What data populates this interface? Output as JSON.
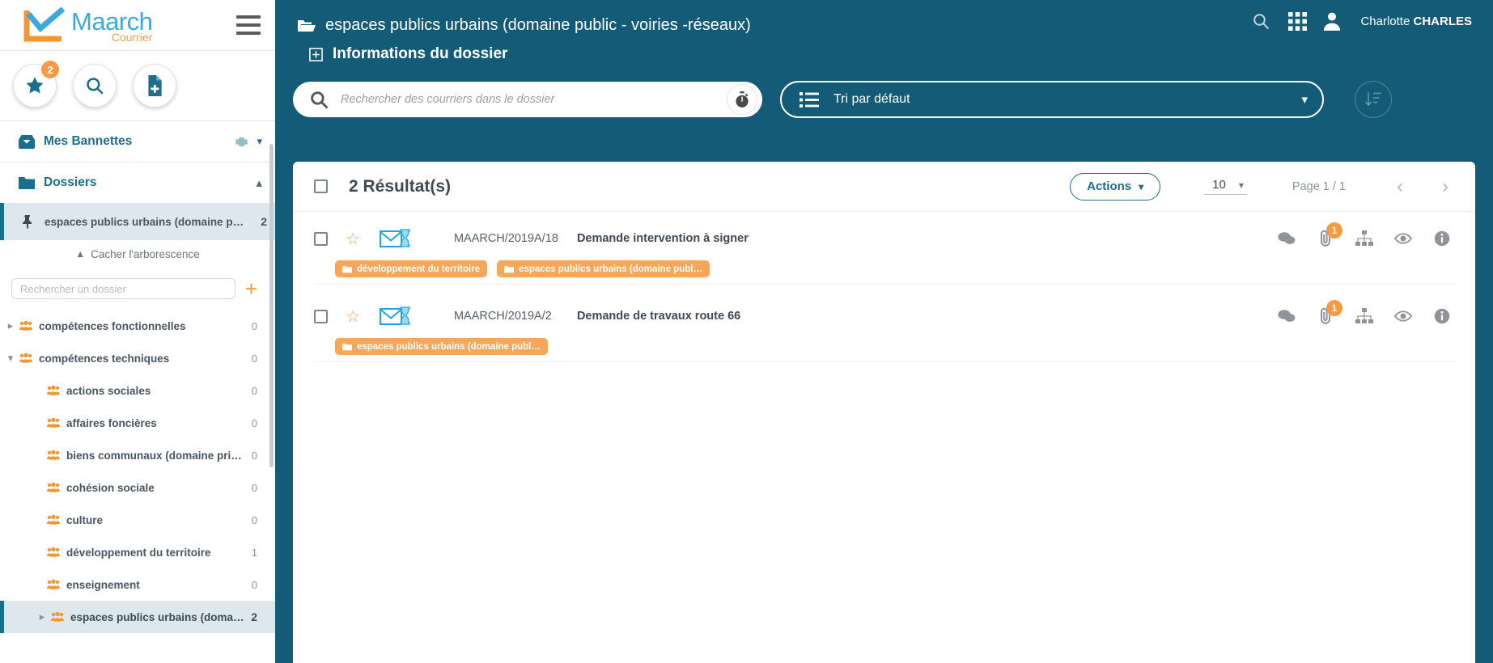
{
  "brand": {
    "name": "Maarch",
    "sub": "Courrier"
  },
  "sidebar": {
    "quick_actions": [
      {
        "name": "favorites-button",
        "icon": "star-icon",
        "badge": "2"
      },
      {
        "name": "search-button",
        "icon": "search-icon",
        "badge": ""
      },
      {
        "name": "new-document-button",
        "icon": "document-add-icon",
        "badge": ""
      }
    ],
    "baskets": {
      "label": "Mes Bannettes",
      "icon": "inbox-icon",
      "gear": "gear-icon"
    },
    "folders": {
      "label": "Dossiers",
      "icon": "folder-icon"
    },
    "pinned_folder": {
      "label": "espaces publics urbains (domaine public - voi…",
      "count": "2",
      "icon": "pin-icon"
    },
    "hide_tree_label": "Cacher l'arborescence",
    "tree_search_placeholder": "Rechercher un dossier",
    "add_folder_label": "+",
    "tree": [
      {
        "label": "compétences fonctionnelles",
        "count": "0",
        "level": 1,
        "expanded": false,
        "has_children": true,
        "active": false
      },
      {
        "label": "compétences techniques",
        "count": "0",
        "level": 1,
        "expanded": true,
        "has_children": true,
        "active": false
      },
      {
        "label": "actions sociales",
        "count": "0",
        "level": 2,
        "expanded": false,
        "has_children": false,
        "active": false
      },
      {
        "label": "affaires foncières",
        "count": "0",
        "level": 2,
        "expanded": false,
        "has_children": false,
        "active": false
      },
      {
        "label": "biens communaux (domaine privé)",
        "count": "0",
        "level": 2,
        "expanded": false,
        "has_children": false,
        "active": false
      },
      {
        "label": "cohésion sociale",
        "count": "0",
        "level": 2,
        "expanded": false,
        "has_children": false,
        "active": false
      },
      {
        "label": "culture",
        "count": "0",
        "level": 2,
        "expanded": false,
        "has_children": false,
        "active": false
      },
      {
        "label": "développement du territoire",
        "count": "1",
        "level": 2,
        "expanded": false,
        "has_children": false,
        "active": false
      },
      {
        "label": "enseignement",
        "count": "0",
        "level": 2,
        "expanded": false,
        "has_children": false,
        "active": false
      },
      {
        "label": "espaces publics urbains (domaine pu…",
        "count": "2",
        "level": 2,
        "expanded": false,
        "has_children": true,
        "active": true
      }
    ]
  },
  "header": {
    "breadcrumb": "espaces publics urbains (domaine public - voiries -réseaux)",
    "breadcrumb_icon": "folder-open-icon",
    "info_label": "Informations du dossier",
    "info_icon": "plus-box-icon",
    "top_icons": [
      {
        "name": "search-icon"
      },
      {
        "name": "apps-grid-icon"
      }
    ],
    "user": {
      "first": "Charlotte",
      "last": "CHARLES",
      "avatar": "user-avatar-icon"
    }
  },
  "search": {
    "placeholder": "Rechercher des courriers dans le dossier",
    "value": "",
    "icon": "search-icon",
    "chrono_icon": "stopwatch-icon"
  },
  "sort": {
    "label": "Tri par défaut",
    "icon": "list-icon",
    "chevron": "chevron-down-icon",
    "direction_icon": "sort-descending-icon"
  },
  "results": {
    "count_label": "2 Résultat(s)",
    "actions_label": "Actions",
    "per_page": "10",
    "page_label": "Page 1 / 1",
    "prev_icon": "chevron-left-icon",
    "next_icon": "chevron-right-icon",
    "rows": [
      {
        "chrono": "MAARCH/2019A/18",
        "subject": "Demande intervention à signer",
        "star_icon": "star-outline-icon",
        "mail_icon": "mail-pending-icon",
        "attachment_badge": "1",
        "tags": [
          "développement du territoire",
          "espaces publics urbains (domaine publ…"
        ],
        "icons": [
          "comment-icon",
          "attachment-icon",
          "hierarchy-icon",
          "eye-icon",
          "info-icon"
        ]
      },
      {
        "chrono": "MAARCH/2019A/2",
        "subject": "Demande de travaux route 66",
        "star_icon": "star-outline-icon",
        "mail_icon": "mail-pending-icon",
        "attachment_badge": "1",
        "tags": [
          "espaces publics urbains (domaine publ…"
        ],
        "icons": [
          "comment-icon",
          "attachment-icon",
          "hierarchy-icon",
          "eye-icon",
          "info-icon"
        ]
      }
    ]
  },
  "colors": {
    "primary": "#135b77",
    "accent_blue": "#1a6e8e",
    "orange": "#f5a04c",
    "tag_orange": "#f7a75a",
    "logo_blue": "#3aa9e0"
  }
}
